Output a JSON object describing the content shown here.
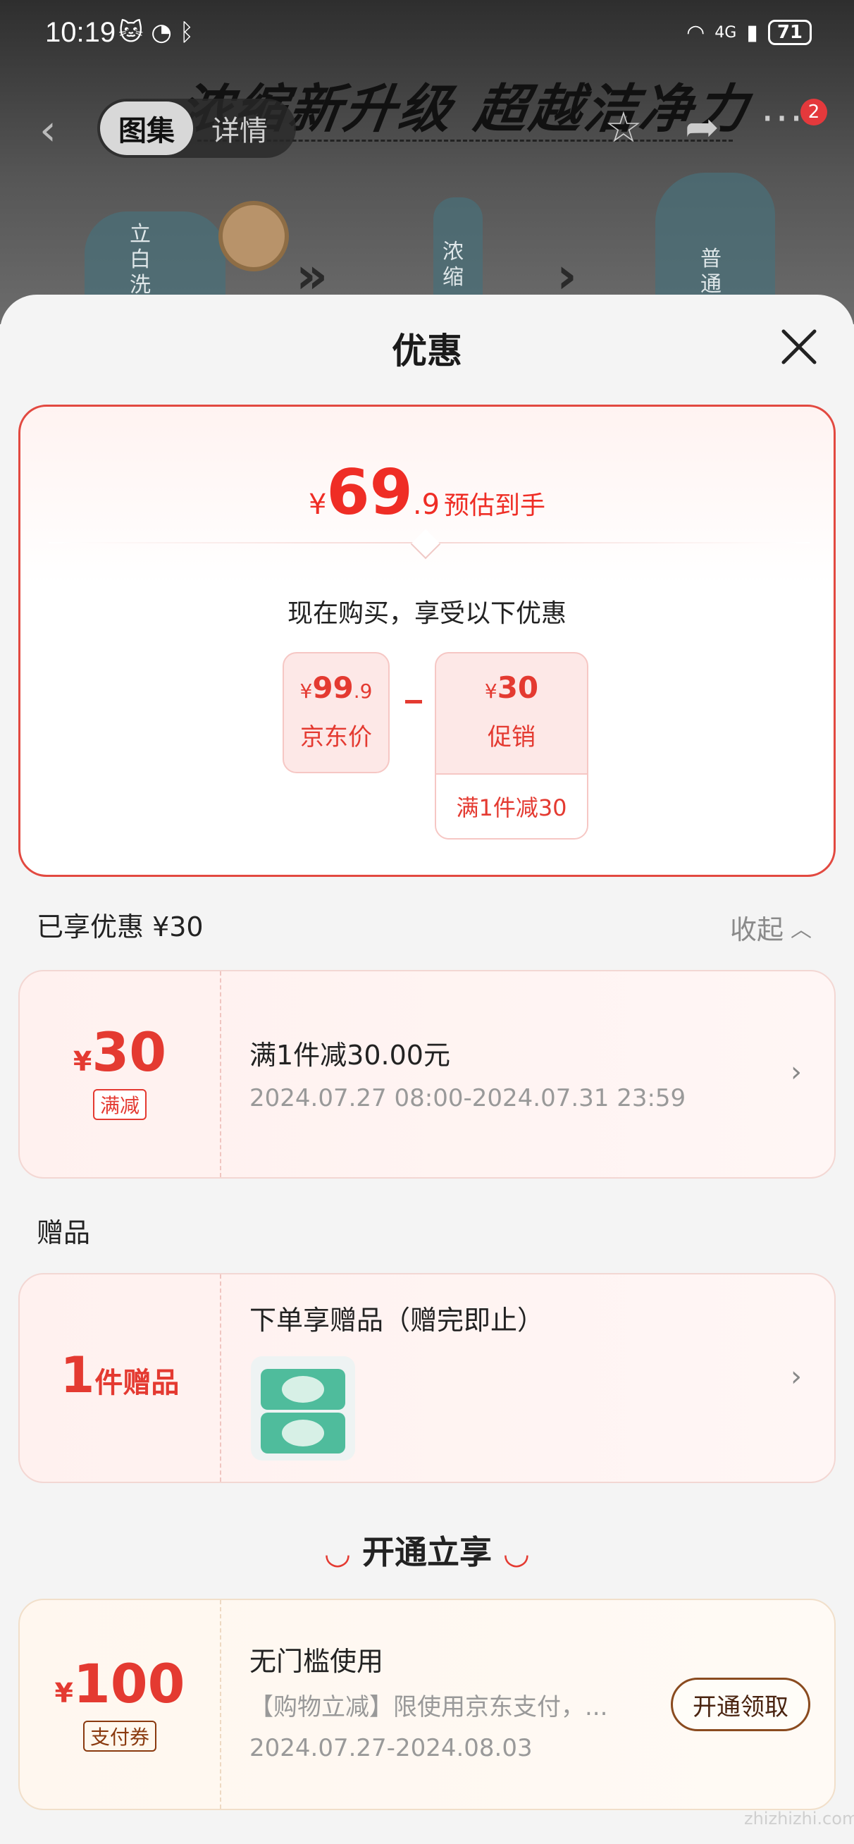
{
  "status_bar": {
    "time": "10:19",
    "battery": "71",
    "network": "4G"
  },
  "background": {
    "banner": "浓缩新升级 超越洁净力",
    "bottle_labels": [
      "立白洗",
      "浓缩",
      "普通"
    ]
  },
  "topnav": {
    "tab_active": "图集",
    "tab_inactive": "详情",
    "notification_count": "2"
  },
  "sheet": {
    "title": "优惠",
    "summary": {
      "currency": "¥",
      "price_int": "69",
      "price_dec": ".9",
      "price_label": "预估到手",
      "enjoy_text": "现在购买，享受以下优惠",
      "jd_price": {
        "currency": "¥",
        "int": "99",
        "dec": ".9",
        "label": "京东价"
      },
      "promo": {
        "currency": "¥",
        "amount": "30",
        "label": "促销",
        "rule": "满1件减30"
      }
    },
    "enjoyed": {
      "label": "已享优惠 ¥30",
      "collapse": "收起"
    },
    "discount_coupon": {
      "currency": "¥",
      "amount": "30",
      "tag": "满减",
      "title": "满1件减30.00元",
      "validity": "2024.07.27 08:00-2024.07.31 23:59"
    },
    "gift_section": {
      "heading": "赠品"
    },
    "gift": {
      "count": "1",
      "count_label": "件赠品",
      "title": "下单享赠品（赠完即止）"
    },
    "open_section": {
      "heading": "开通立享"
    },
    "pay_coupon": {
      "currency": "¥",
      "amount": "100",
      "tag": "支付券",
      "title": "无门槛使用",
      "desc": "【购物立减】限使用京东支付，...",
      "validity": "2024.07.27-2024.08.03",
      "button": "开通领取"
    }
  },
  "watermark": "zhizhizhi.com",
  "colors": {
    "accent": "#e43a31",
    "brand_brown": "#8a3a0f"
  }
}
